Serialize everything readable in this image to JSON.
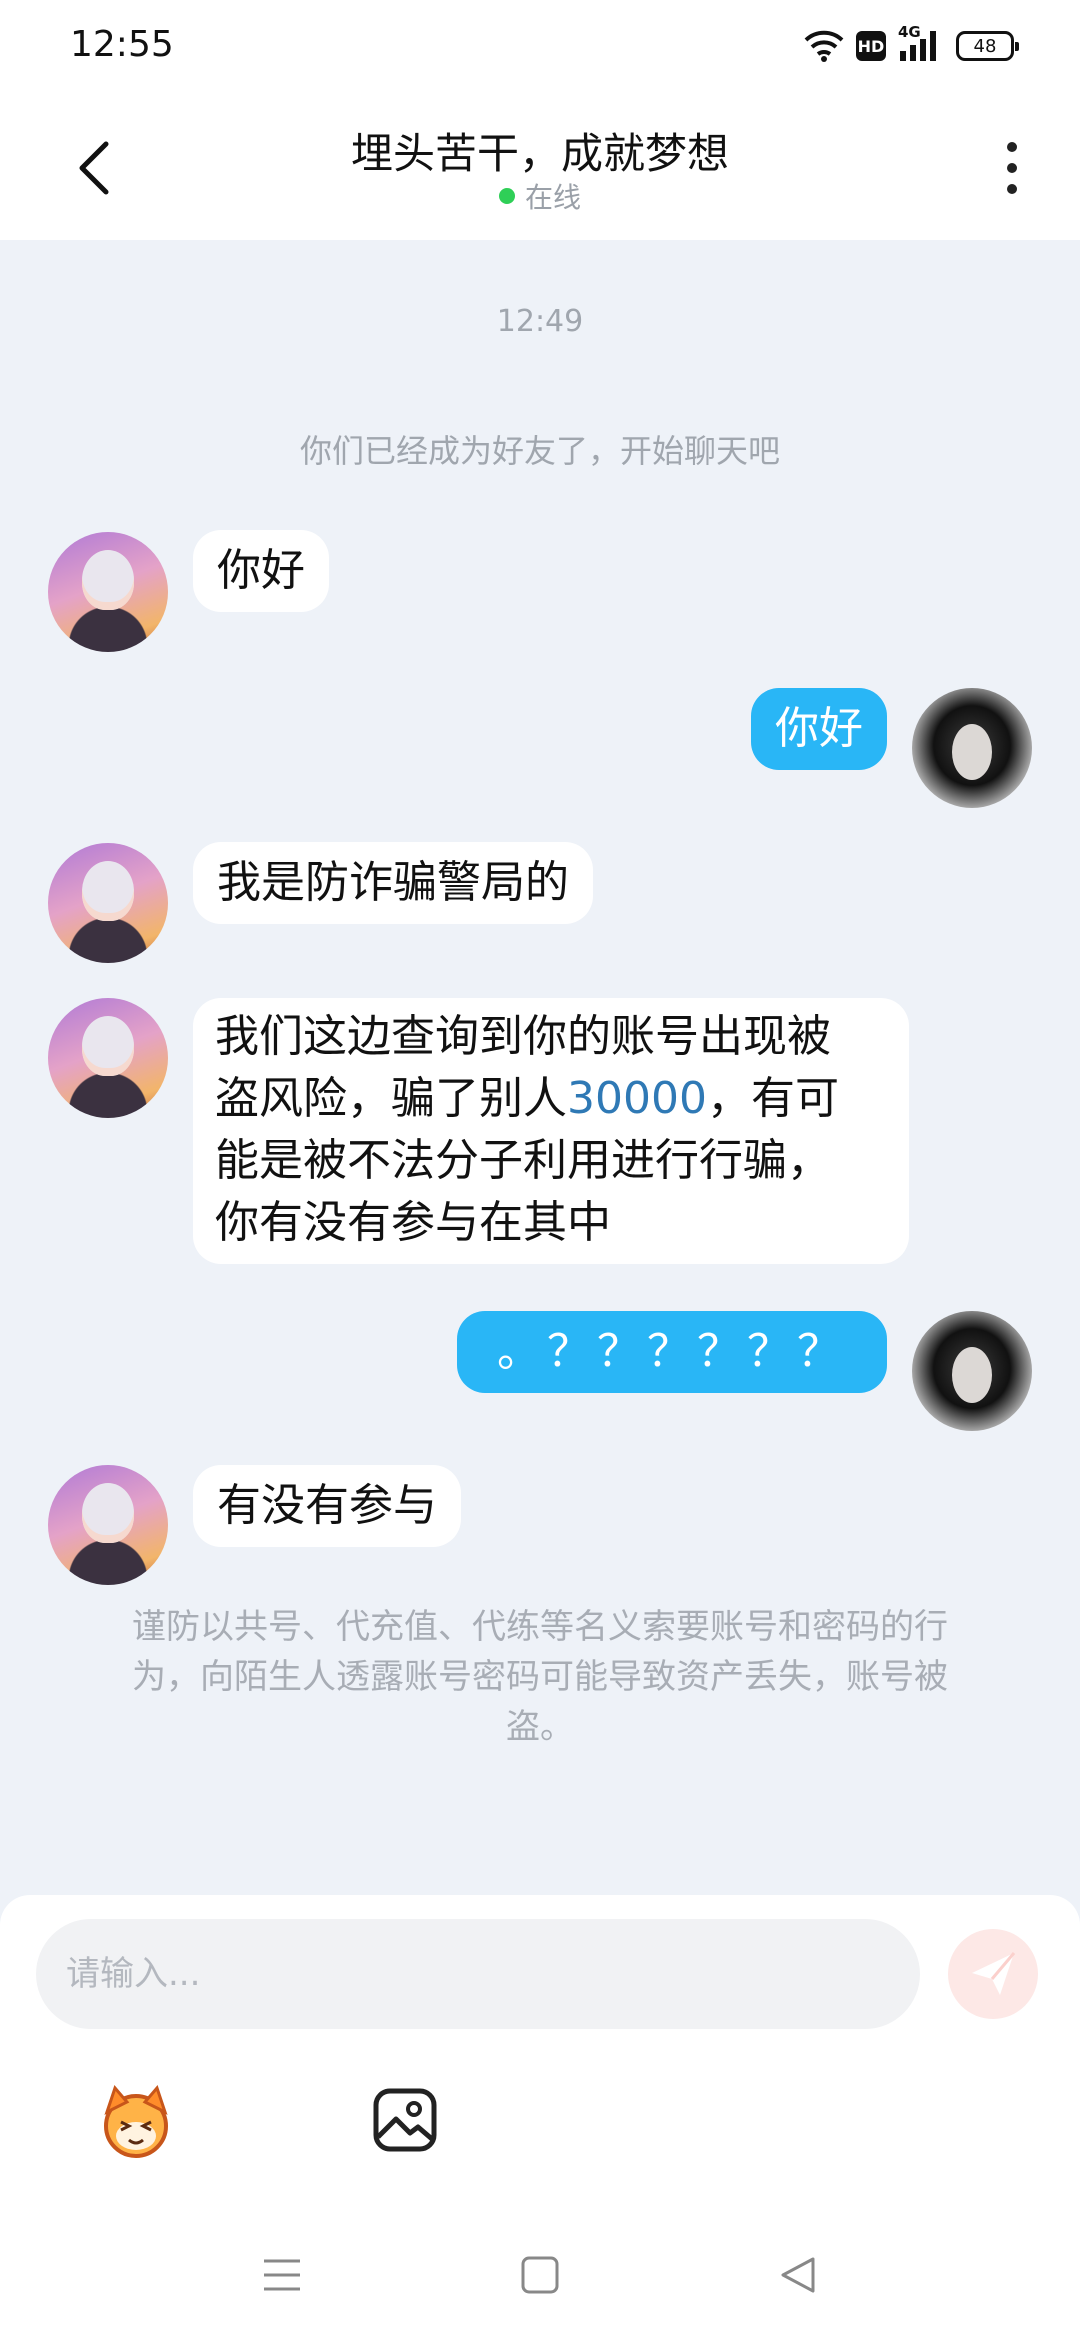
{
  "status_bar": {
    "time": "12:55",
    "hd_label": "HD",
    "network_label": "4G",
    "battery_level": "48",
    "icons": [
      "wifi-icon",
      "hd-icon",
      "signal-icon",
      "battery-icon"
    ]
  },
  "header": {
    "title": "埋头苦干，成就梦想",
    "status": "在线",
    "status_color": "#2fcf57",
    "back_icon": "chevron-left-icon",
    "more_icon": "more-vertical-icon"
  },
  "chat": {
    "timestamp": "12:49",
    "system_note": "你们已经成为好友了，开始聊天吧",
    "messages": [
      {
        "direction": "in",
        "text": "你好"
      },
      {
        "direction": "out",
        "text": "你好"
      },
      {
        "direction": "in",
        "text": "我是防诈骗警局的"
      },
      {
        "direction": "in",
        "text_parts": [
          "我们这边查询到你的账号出现被",
          "盗风险，骗了别人",
          "30000",
          "，有可",
          "能是被不法分子利用进行行骗，",
          "你有没有参与在其中"
        ]
      },
      {
        "direction": "out",
        "text": "。？？？？？？"
      },
      {
        "direction": "in",
        "text": "有没有参与"
      }
    ],
    "safety_note": "谨防以共号、代充值、代练等名义索要账号和密码的行为，向陌生人透露账号密码可能导致资产丢失，账号被盗。"
  },
  "input": {
    "placeholder": "请输入...",
    "send_icon": "send-icon",
    "tools": [
      "sticker-icon",
      "image-icon"
    ]
  },
  "nav": {
    "icons": [
      "menu-icon",
      "home-icon",
      "back-triangle-icon"
    ]
  },
  "colors": {
    "accent": "#29b6f6",
    "background": "#eef2f8",
    "link": "#2f79b5"
  }
}
